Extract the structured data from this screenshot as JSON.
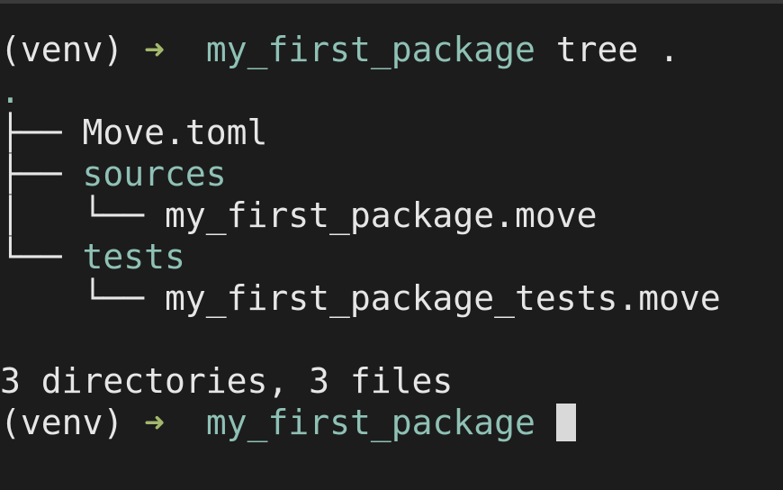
{
  "prompt": {
    "venv": "(venv)",
    "arrow": "➜",
    "dir": "my_first_package"
  },
  "command": "tree .",
  "tree": {
    "root": ".",
    "items": [
      {
        "prefix": "├── ",
        "name": "Move.toml",
        "type": "file"
      },
      {
        "prefix": "├── ",
        "name": "sources",
        "type": "dir"
      },
      {
        "prefix": "│   └── ",
        "name": "my_first_package.move",
        "type": "file"
      },
      {
        "prefix": "└── ",
        "name": "tests",
        "type": "dir"
      },
      {
        "prefix": "    └── ",
        "name": "my_first_package_tests.move",
        "type": "file"
      }
    ]
  },
  "summary": "3 directories, 3 files",
  "colors": {
    "background": "#1c1c1c",
    "text": "#e6e6e6",
    "directory": "#8fc1b5",
    "arrow": "#a3b86c"
  }
}
